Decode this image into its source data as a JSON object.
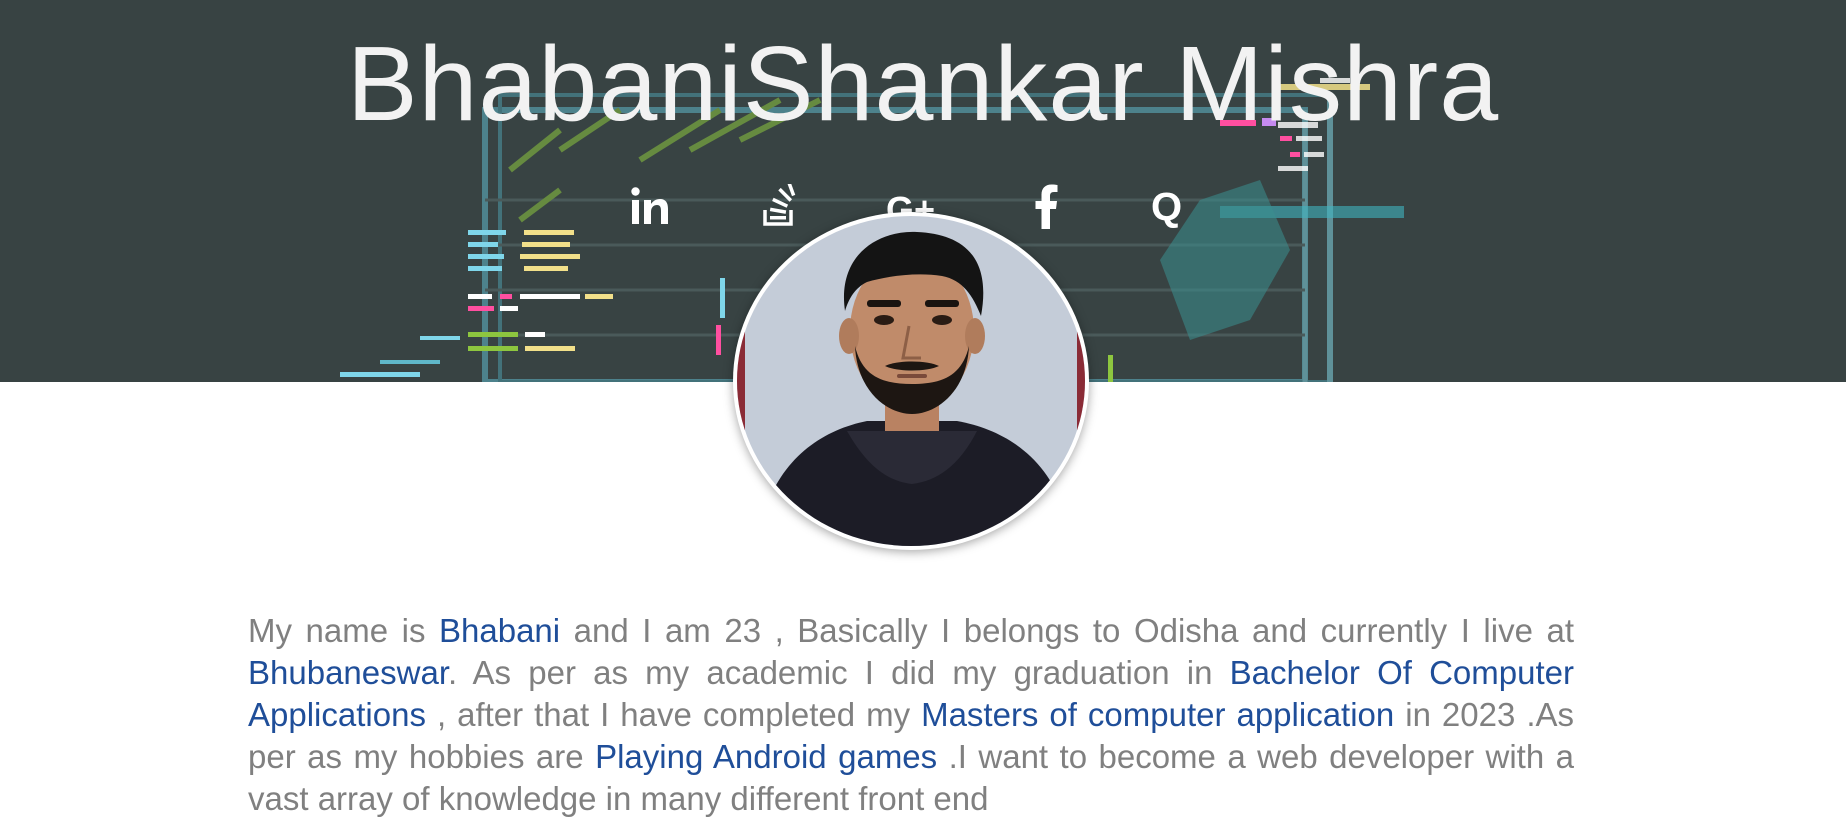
{
  "header": {
    "title": "BhabaniShankar Mishra",
    "background_color": "#384343"
  },
  "social_links": [
    {
      "icon": "linkedin-icon",
      "label": "LinkedIn"
    },
    {
      "icon": "stackoverflow-icon",
      "label": "Stack Overflow"
    },
    {
      "icon": "google-plus-icon",
      "label": "Google Plus"
    },
    {
      "icon": "facebook-icon",
      "label": "Facebook"
    },
    {
      "icon": "quora-icon",
      "label": "Quora"
    }
  ],
  "profile": {
    "photo": "profile-photo"
  },
  "bio": {
    "p1": "My name is ",
    "name": "Bhabani",
    "p2": " and I am 23 , Basically I belongs to Odisha and currently I live at ",
    "city": "Bhubaneswar",
    "p3": ". As per as my academic I did my graduation in ",
    "degree1": "Bachelor Of Computer Applications",
    "p4": " , after that I have completed my ",
    "degree2": "Masters of computer application",
    "p5": " in 2023 .As per as my hobbies are ",
    "hobby": "Playing Android games",
    "p6": " .I want to become a web developer with a vast array of knowledge in many different front end",
    "text_color": "#808080",
    "highlight_color": "#1f4e99"
  }
}
